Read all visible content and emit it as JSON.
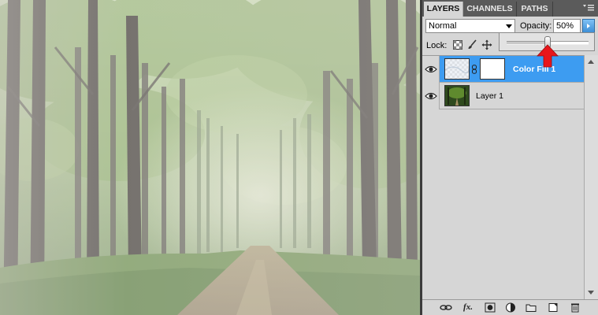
{
  "panel": {
    "tabs": [
      {
        "label": "LAYERS",
        "active": true
      },
      {
        "label": "CHANNELS",
        "active": false
      },
      {
        "label": "PATHS",
        "active": false
      }
    ],
    "menu_icon": "panel-menu-icon",
    "blend_mode": "Normal",
    "opacity_label": "Opacity:",
    "opacity_value": "50%",
    "opacity_fraction": 0.5,
    "lock_label": "Lock:",
    "lock_icons": [
      "lock-transparent-icon",
      "lock-image-icon",
      "lock-position-icon"
    ],
    "layers": [
      {
        "name": "Color Fill 1",
        "selected": true,
        "visible": true
      },
      {
        "name": "Layer 1",
        "selected": false,
        "visible": true
      }
    ],
    "bottom_icons": [
      "link-layers-icon",
      "layer-style-icon",
      "add-mask-icon",
      "adjustment-layer-icon",
      "new-group-icon",
      "new-layer-icon",
      "delete-layer-icon"
    ],
    "bottom_glyphs": {
      "style": "fx."
    }
  },
  "colors": {
    "selection": "#3d9cf1",
    "callout_arrow": "#e8161b",
    "panel_bg": "#d6d6d6"
  }
}
